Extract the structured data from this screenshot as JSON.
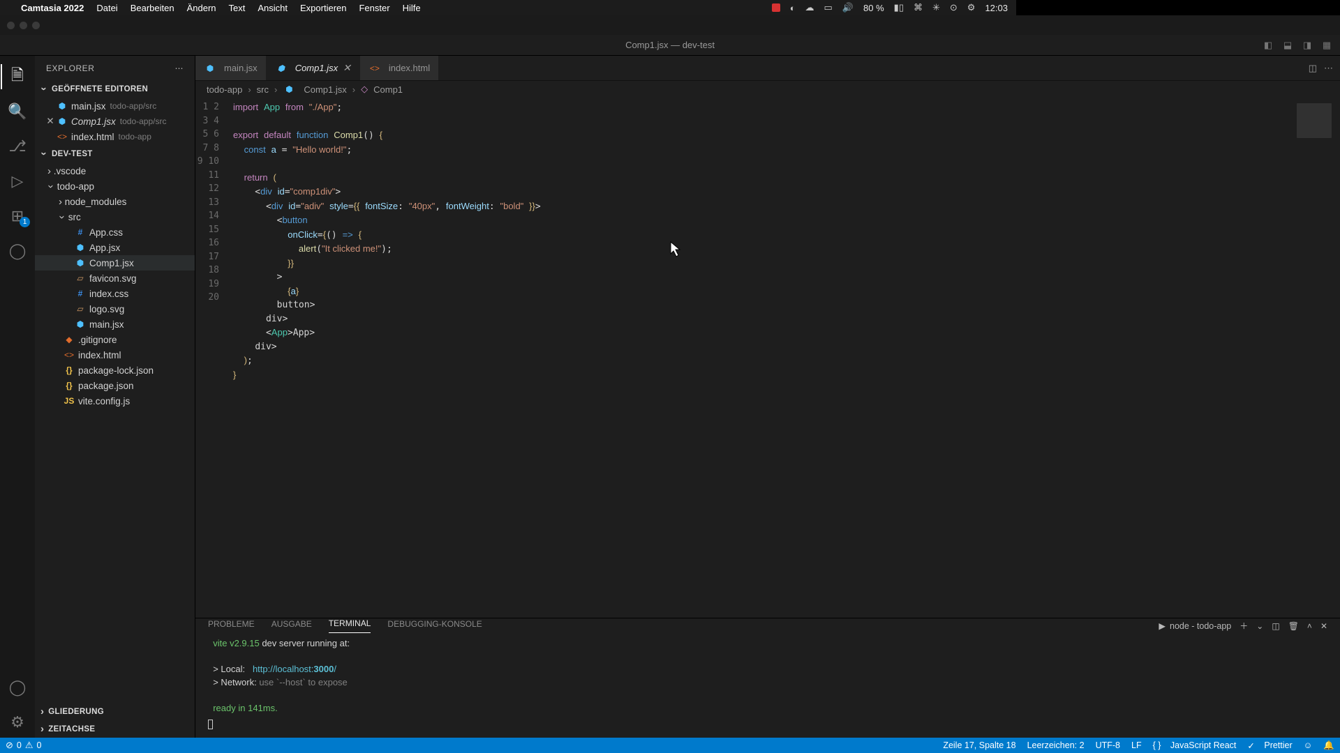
{
  "mac_menu": {
    "app": "Camtasia 2022",
    "items": [
      "Datei",
      "Bearbeiten",
      "Ändern",
      "Text",
      "Ansicht",
      "Exportieren",
      "Fenster",
      "Hilfe"
    ],
    "battery": "80 %",
    "time": "12:03"
  },
  "window_title": "Comp1.jsx — dev-test",
  "explorer": {
    "title": "EXPLORER",
    "open_editors_label": "GEÖFFNETE EDITOREN",
    "open_editors": [
      {
        "name": "main.jsx",
        "dir": "todo-app/src",
        "icon": "react",
        "modified": false
      },
      {
        "name": "Comp1.jsx",
        "dir": "todo-app/src",
        "icon": "react",
        "modified": true
      },
      {
        "name": "index.html",
        "dir": "todo-app",
        "icon": "html",
        "modified": false
      }
    ],
    "workspace_label": "DEV-TEST",
    "tree": {
      "vscode": ".vscode",
      "todoapp": "todo-app",
      "node_modules": "node_modules",
      "src": "src",
      "files_src": [
        {
          "name": "App.css",
          "icon": "css"
        },
        {
          "name": "App.jsx",
          "icon": "react"
        },
        {
          "name": "Comp1.jsx",
          "icon": "react",
          "selected": true
        },
        {
          "name": "favicon.svg",
          "icon": "svg"
        },
        {
          "name": "index.css",
          "icon": "css"
        },
        {
          "name": "logo.svg",
          "icon": "svg"
        },
        {
          "name": "main.jsx",
          "icon": "react"
        }
      ],
      "files_root": [
        {
          "name": ".gitignore",
          "icon": "git"
        },
        {
          "name": "index.html",
          "icon": "html"
        },
        {
          "name": "package-lock.json",
          "icon": "json"
        },
        {
          "name": "package.json",
          "icon": "json"
        },
        {
          "name": "vite.config.js",
          "icon": "js"
        }
      ]
    },
    "outline_label": "GLIEDERUNG",
    "timeline_label": "ZEITACHSE"
  },
  "tabs": [
    {
      "name": "main.jsx",
      "icon": "react",
      "active": false
    },
    {
      "name": "Comp1.jsx",
      "icon": "react",
      "active": true,
      "modified": true
    },
    {
      "name": "index.html",
      "icon": "html",
      "active": false
    }
  ],
  "breadcrumbs": [
    "todo-app",
    "src",
    "Comp1.jsx",
    "Comp1"
  ],
  "code_lines": [
    [
      [
        "keyword",
        "import"
      ],
      [
        "",
        " "
      ],
      [
        "module",
        "App"
      ],
      [
        "",
        " "
      ],
      [
        "keyword",
        "from"
      ],
      [
        "",
        " "
      ],
      [
        "string",
        "\"./App\""
      ],
      [
        "",
        ";"
      ]
    ],
    [
      [
        "",
        ""
      ]
    ],
    [
      [
        "keyword",
        "export"
      ],
      [
        "",
        " "
      ],
      [
        "keyword",
        "default"
      ],
      [
        "",
        " "
      ],
      [
        "const",
        "function"
      ],
      [
        "",
        " "
      ],
      [
        "func",
        "Comp1"
      ],
      [
        "",
        "()"
      ],
      [
        "",
        " "
      ],
      [
        "brace",
        "{"
      ]
    ],
    [
      [
        "",
        "  "
      ],
      [
        "const",
        "const"
      ],
      [
        "",
        " "
      ],
      [
        "var",
        "a"
      ],
      [
        "",
        " "
      ],
      [
        "",
        "="
      ],
      [
        "",
        " "
      ],
      [
        "string",
        "\"Hello world!\""
      ],
      [
        "",
        ";"
      ]
    ],
    [
      [
        "",
        ""
      ]
    ],
    [
      [
        "",
        "  "
      ],
      [
        "keyword",
        "return"
      ],
      [
        "",
        " "
      ],
      [
        "brace",
        "("
      ]
    ],
    [
      [
        "",
        "    "
      ],
      [
        "",
        "<"
      ],
      [
        "tag",
        "div"
      ],
      [
        "",
        " "
      ],
      [
        "attr",
        "id"
      ],
      [
        "",
        "="
      ],
      [
        "string",
        "\"comp1div\""
      ],
      [
        "",
        ">"
      ]
    ],
    [
      [
        "",
        "      "
      ],
      [
        "",
        "<"
      ],
      [
        "tag",
        "div"
      ],
      [
        "",
        " "
      ],
      [
        "attr",
        "id"
      ],
      [
        "",
        "="
      ],
      [
        "string",
        "\"adiv\""
      ],
      [
        "",
        " "
      ],
      [
        "attr",
        "style"
      ],
      [
        "",
        "="
      ],
      [
        "brace",
        "{{"
      ],
      [
        "",
        " "
      ],
      [
        "attr",
        "fontSize"
      ],
      [
        "",
        ":"
      ],
      [
        "",
        " "
      ],
      [
        "string",
        "\"40px\""
      ],
      [
        "",
        ","
      ],
      [
        "",
        " "
      ],
      [
        "attr",
        "fontWeight"
      ],
      [
        "",
        ":"
      ],
      [
        "",
        " "
      ],
      [
        "string",
        "\"bold\""
      ],
      [
        "",
        " "
      ],
      [
        "brace",
        "}}"
      ],
      [
        "",
        ">"
      ]
    ],
    [
      [
        "",
        "        "
      ],
      [
        "",
        "<"
      ],
      [
        "tag",
        "button"
      ]
    ],
    [
      [
        "",
        "          "
      ],
      [
        "attr",
        "onClick"
      ],
      [
        "",
        "="
      ],
      [
        "brace",
        "{"
      ],
      [
        "",
        "()"
      ],
      [
        "",
        " "
      ],
      [
        "const",
        "=>"
      ],
      [
        "",
        " "
      ],
      [
        "brace",
        "{"
      ]
    ],
    [
      [
        "",
        "            "
      ],
      [
        "func",
        "alert"
      ],
      [
        "",
        "("
      ],
      [
        "string",
        "\"It clicked me!\""
      ],
      [
        "",
        ")"
      ],
      [
        "",
        ";"
      ]
    ],
    [
      [
        "",
        "          "
      ],
      [
        "brace",
        "}}"
      ]
    ],
    [
      [
        "",
        "        "
      ],
      [
        "",
        ">"
      ]
    ],
    [
      [
        "",
        "          "
      ],
      [
        "brace",
        "{"
      ],
      [
        "var",
        "a"
      ],
      [
        "brace",
        "}"
      ]
    ],
    [
      [
        "",
        "        "
      ],
      [
        "",
        "</"
      ],
      [
        "tag",
        "button"
      ],
      [
        "",
        ">"
      ]
    ],
    [
      [
        "",
        "      "
      ],
      [
        "",
        "</"
      ],
      [
        "tag",
        "div"
      ],
      [
        "",
        ">"
      ]
    ],
    [
      [
        "",
        "      "
      ],
      [
        "",
        "<"
      ],
      [
        "module",
        "App"
      ],
      [
        "",
        "></"
      ],
      [
        "module",
        "App"
      ],
      [
        "",
        ">"
      ]
    ],
    [
      [
        "",
        "    "
      ],
      [
        "",
        "</"
      ],
      [
        "tag",
        "div"
      ],
      [
        "",
        ">"
      ]
    ],
    [
      [
        "",
        "  "
      ],
      [
        "brace",
        ")"
      ],
      [
        "",
        ";"
      ]
    ],
    [
      [
        "brace",
        "}"
      ]
    ]
  ],
  "panel": {
    "tabs": [
      "PROBLEME",
      "AUSGABE",
      "TERMINAL",
      "DEBUGGING-KONSOLE"
    ],
    "active_tab": "TERMINAL",
    "terminal_label": "node - todo-app",
    "lines": {
      "l1_a": "  vite v2.9.15",
      "l1_b": " dev server running at:",
      "l2": "  > Local:   ",
      "l2_url_a": "http://localhost:",
      "l2_url_b": "3000",
      "l2_url_c": "/",
      "l3": "  > Network: ",
      "l3_b": "use `--host` to expose",
      "l4": "  ready in 141ms."
    }
  },
  "statusbar": {
    "errors": "0",
    "warnings": "0",
    "cursor": "Zeile 17, Spalte 18",
    "spaces": "Leerzeichen: 2",
    "encoding": "UTF-8",
    "eol": "LF",
    "lang": "JavaScript React",
    "prettier": "Prettier"
  },
  "activity_badge": "1"
}
